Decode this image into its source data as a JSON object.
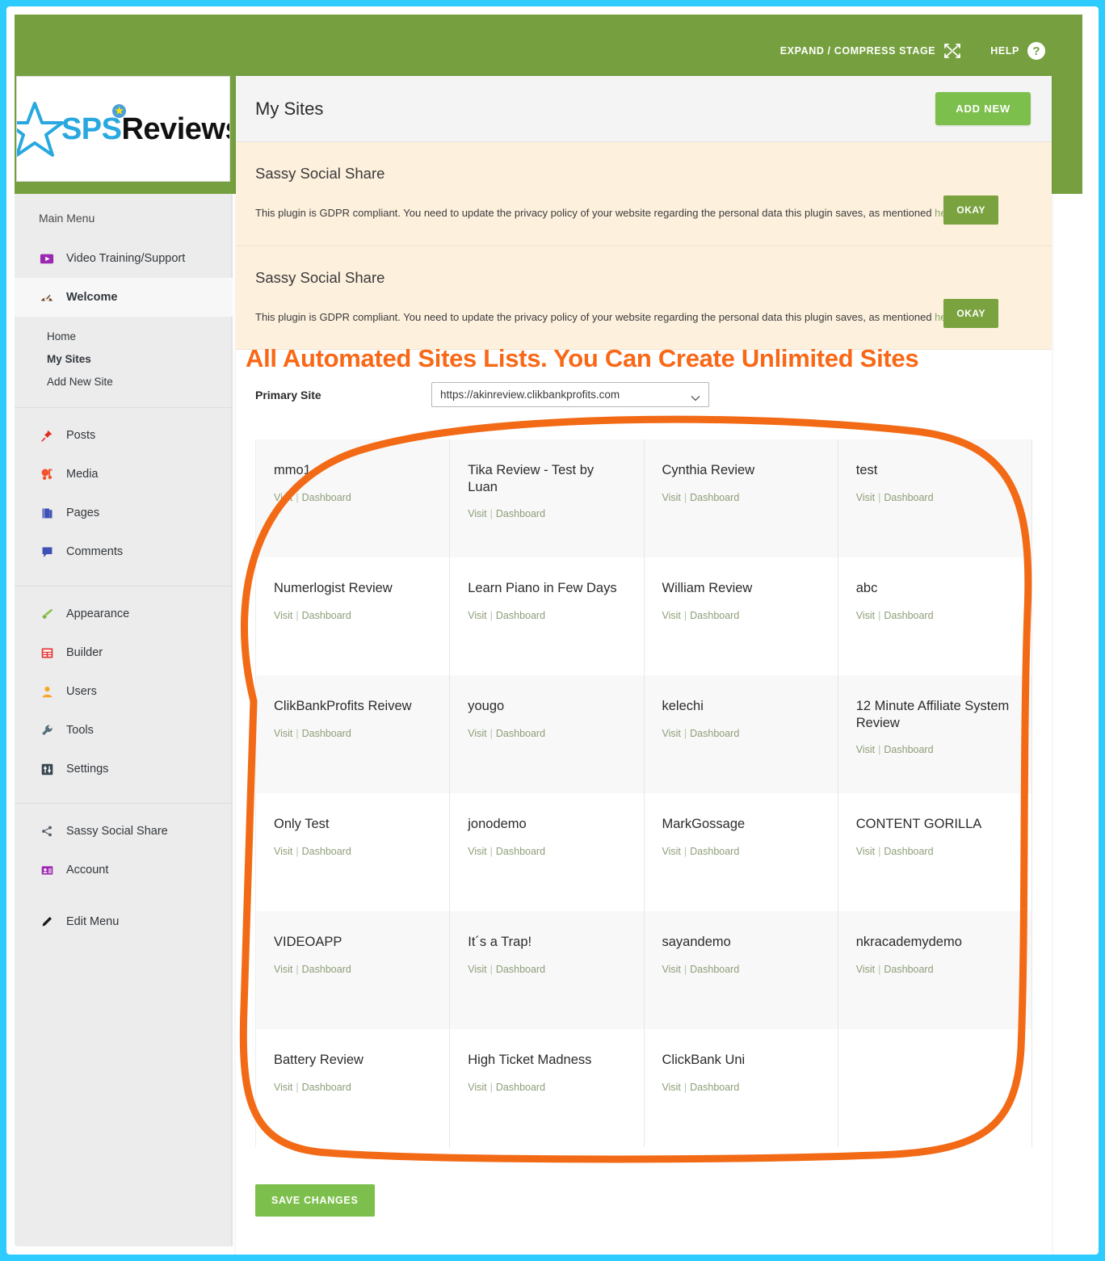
{
  "topbar": {
    "expand_label": "EXPAND / COMPRESS STAGE",
    "help_label": "HELP",
    "help_icon_glyph": "?",
    "bg_color": "#76a03f"
  },
  "logo": {
    "text_primary": "SPS",
    "text_secondary": "Reviews",
    "primary_color": "#29a8e0",
    "secondary_color": "#111111"
  },
  "sidebar": {
    "section_label": "Main Menu",
    "items": [
      {
        "label": "Video Training/Support",
        "icon": "video-play-icon",
        "active": false
      },
      {
        "label": "Welcome",
        "icon": "dashboard-gauge-icon",
        "active": true
      }
    ],
    "subitems": [
      {
        "label": "Home",
        "current": false
      },
      {
        "label": "My Sites",
        "current": true
      },
      {
        "label": "Add New Site",
        "current": false
      }
    ],
    "group2": [
      {
        "label": "Posts",
        "icon": "pin-icon"
      },
      {
        "label": "Media",
        "icon": "media-icon"
      },
      {
        "label": "Pages",
        "icon": "pages-icon"
      },
      {
        "label": "Comments",
        "icon": "comment-bubble-icon"
      }
    ],
    "group3": [
      {
        "label": "Appearance",
        "icon": "paintbrush-icon"
      },
      {
        "label": "Builder",
        "icon": "builder-grid-icon"
      },
      {
        "label": "Users",
        "icon": "user-icon"
      },
      {
        "label": "Tools",
        "icon": "wrench-icon"
      },
      {
        "label": "Settings",
        "icon": "settings-sliders-icon"
      }
    ],
    "group4": [
      {
        "label": "Sassy Social Share",
        "icon": "share-icon"
      },
      {
        "label": "Account",
        "icon": "id-card-icon"
      }
    ],
    "group5": [
      {
        "label": "Edit Menu",
        "icon": "pencil-icon"
      }
    ]
  },
  "header": {
    "title": "My Sites",
    "add_new_label": "ADD NEW",
    "add_new_color": "#7dbf4c"
  },
  "notices": [
    {
      "title": "Sassy Social Share",
      "body_before_link": "This plugin is GDPR compliant. You need to update the privacy policy of your website regarding the personal data this plugin saves, as mentioned ",
      "link_text": "here",
      "button_label": "OKAY"
    },
    {
      "title": "Sassy Social Share",
      "body_before_link": "This plugin is GDPR compliant. You need to update the privacy policy of your website regarding the personal data this plugin saves, as mentioned ",
      "link_text": "here",
      "button_label": "OKAY"
    }
  ],
  "annotation": {
    "headline": "All Automated Sites Lists. You Can Create Unlimited Sites",
    "headline_color": "#f96816",
    "ellipse_color": "#f26a15"
  },
  "primary_site": {
    "label": "Primary Site",
    "selected_value": "https://akinreview.clikbankprofits.com"
  },
  "sites": {
    "visit_label": "Visit",
    "separator": "|",
    "dashboard_label": "Dashboard",
    "items": [
      {
        "name": "mmo1"
      },
      {
        "name": "Tika Review - Test by Luan"
      },
      {
        "name": "Cynthia Review"
      },
      {
        "name": "test"
      },
      {
        "name": "Numerlogist Review"
      },
      {
        "name": "Learn Piano in Few Days"
      },
      {
        "name": "William Review"
      },
      {
        "name": "abc"
      },
      {
        "name": "ClikBankProfits Reivew"
      },
      {
        "name": "yougo"
      },
      {
        "name": "kelechi"
      },
      {
        "name": "12 Minute Affiliate System Review"
      },
      {
        "name": "Only Test"
      },
      {
        "name": "jonodemo"
      },
      {
        "name": "MarkGossage"
      },
      {
        "name": "CONTENT GORILLA"
      },
      {
        "name": "VIDEOAPP"
      },
      {
        "name": "It´s a Trap!"
      },
      {
        "name": "sayandemo"
      },
      {
        "name": "nkracademydemo"
      },
      {
        "name": "Battery Review"
      },
      {
        "name": "High Ticket Madness"
      },
      {
        "name": "ClickBank Uni"
      }
    ]
  },
  "footer": {
    "save_label": "SAVE CHANGES",
    "save_color": "#7dbf4c"
  }
}
